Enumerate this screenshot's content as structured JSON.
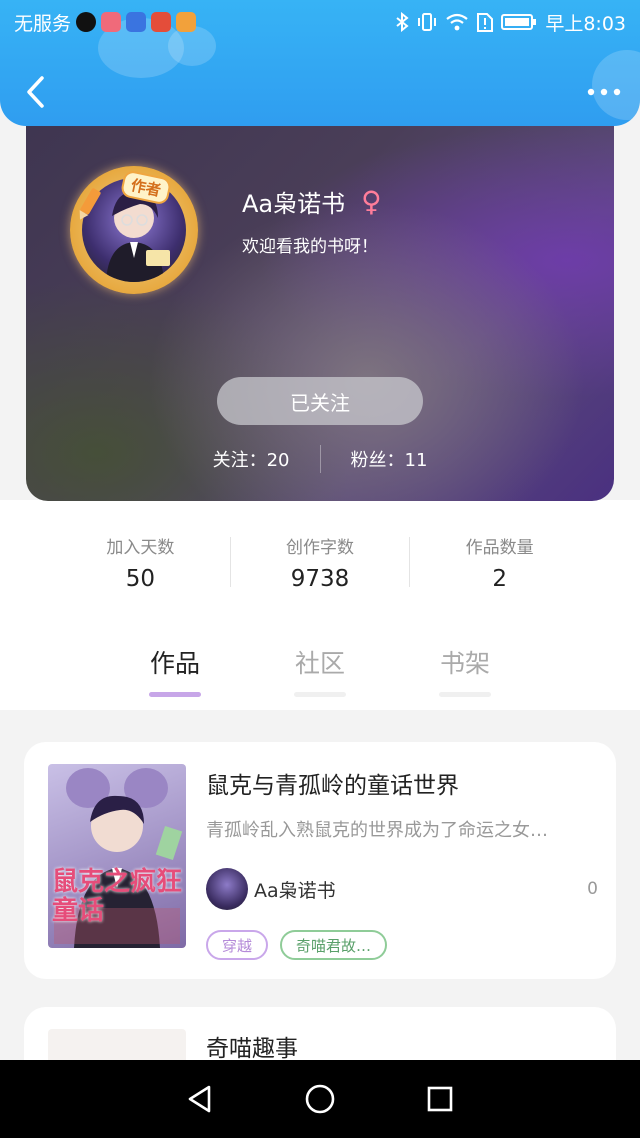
{
  "status_bar": {
    "carrier": "无服务",
    "time": "早上8:03",
    "app_icons": [
      "tiktok-icon",
      "app-icon-red",
      "baidu-icon",
      "news-icon",
      "video-icon"
    ]
  },
  "profile": {
    "author_badge": "作者",
    "nickname": "Aa枭诺书",
    "gender_symbol": "♀",
    "bio": "欢迎看我的书呀！",
    "follow_button": "已关注",
    "following": "关注：20",
    "fans": "粉丝：11"
  },
  "stats": [
    {
      "label": "加入天数",
      "value": "50"
    },
    {
      "label": "创作字数",
      "value": "9738"
    },
    {
      "label": "作品数量",
      "value": "2"
    }
  ],
  "tabs": [
    {
      "label": "作品",
      "active": true
    },
    {
      "label": "社区",
      "active": false
    },
    {
      "label": "书架",
      "active": false
    }
  ],
  "books": [
    {
      "title": "鼠克与青孤岭的童话世界",
      "desc": "青孤岭乱入熟鼠克的世界成为了命运之女…",
      "author": "Aa枭诺书",
      "count": "0",
      "cover_text": "鼠克之疯狂童话",
      "tags": [
        {
          "label": "穿越",
          "color": "#b48ad8"
        },
        {
          "label": "奇喵君故…",
          "color": "#6fb57a"
        }
      ]
    },
    {
      "title": "奇喵趣事"
    }
  ],
  "colors": {
    "header": "#2f9df0",
    "tab_active_underline": "#c7a6e8",
    "tab_inactive_underline": "#f0f0f0"
  }
}
